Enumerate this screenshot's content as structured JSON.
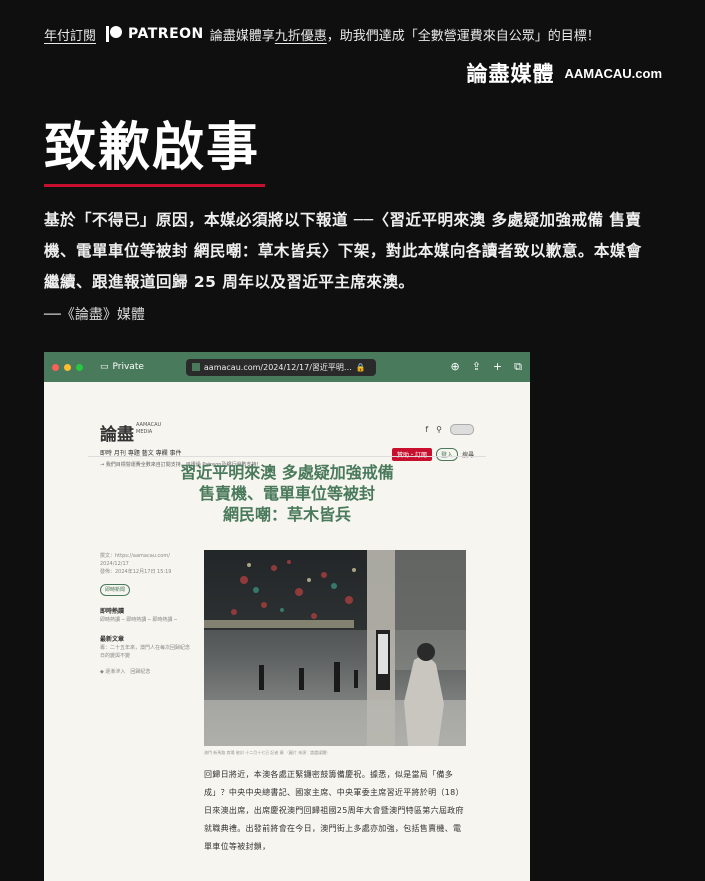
{
  "topbar": {
    "link1": "年付訂閱",
    "patreon": "PATREON",
    "text1": "論盡媒體享",
    "discount": "九折優惠",
    "text2": "，助我們達成「全數營運費來自公眾」的目標！"
  },
  "brand": {
    "cn": "論盡媒體",
    "en": "AAMACAU.com"
  },
  "headline": "致歉啟事",
  "body": "基於「不得已」原因，本媒必須將以下報道 ──〈習近平明來澳 多處疑加強戒備 售賣機、電單車位等被封 網民嘲：草木皆兵〉下架，對此本媒向各讀者致以歉意。本媒會繼續、跟進報道回歸 25 周年以及習近平主席來澳。",
  "signature": "──《論盡》媒體",
  "browser": {
    "private_label": "Private",
    "url": "aamacau.com/2024/12/17/習近平明…",
    "site": {
      "logo": "論盡",
      "logo_sub": "AAMACAU MEDIA",
      "nav": "即時  月刊  專題  藝文  專欄  事件",
      "note": "→ 我們目標營運費全數來自訂閱支持，可透過 Patreon及銀行過數支持！",
      "donate": "贊助・訂閱",
      "login": "登入",
      "search": "搜尋"
    },
    "article_title_lines": [
      "習近平明來澳 多處疑加強戒備",
      "售賣機、電單車位等被封",
      "網民嘲：草木皆兵"
    ],
    "meta_lines": [
      "撰文：https://aamacau.com/",
      "2024/12/17",
      "發佈：2024年12月17日 15:19"
    ],
    "tag": "即時新聞",
    "side_h1": "即時熱讀",
    "side_t1": "即時熱讀 ─ 即時熱讀 ─ 即時熱讀 ─",
    "side_h2": "最新文章",
    "side_t2": "專：二十五年來，澳門人在每次回歸紀念日的變與不變",
    "side_t3": "◆ 逐漸滲入　回歸紀念",
    "caption": "澳門 新馬路 商場 被封 十二月十七日 記者 攝 （圖片 來源：論盡媒體）",
    "paragraph": "回歸日將近，本澳各處正緊鑼密鼓籌備慶祝。據悉，似是當局「備多成」？中央中央總書記、國家主席、中央軍委主席習近平將於明（18）日來澳出席，出席慶祝澳門回歸祖國25周年大會暨澳門特區第六屆政府就職典禮。出發前將會在今日，澳門街上多處亦加強，包括售賣機、電單車位等被封鎖，"
  }
}
